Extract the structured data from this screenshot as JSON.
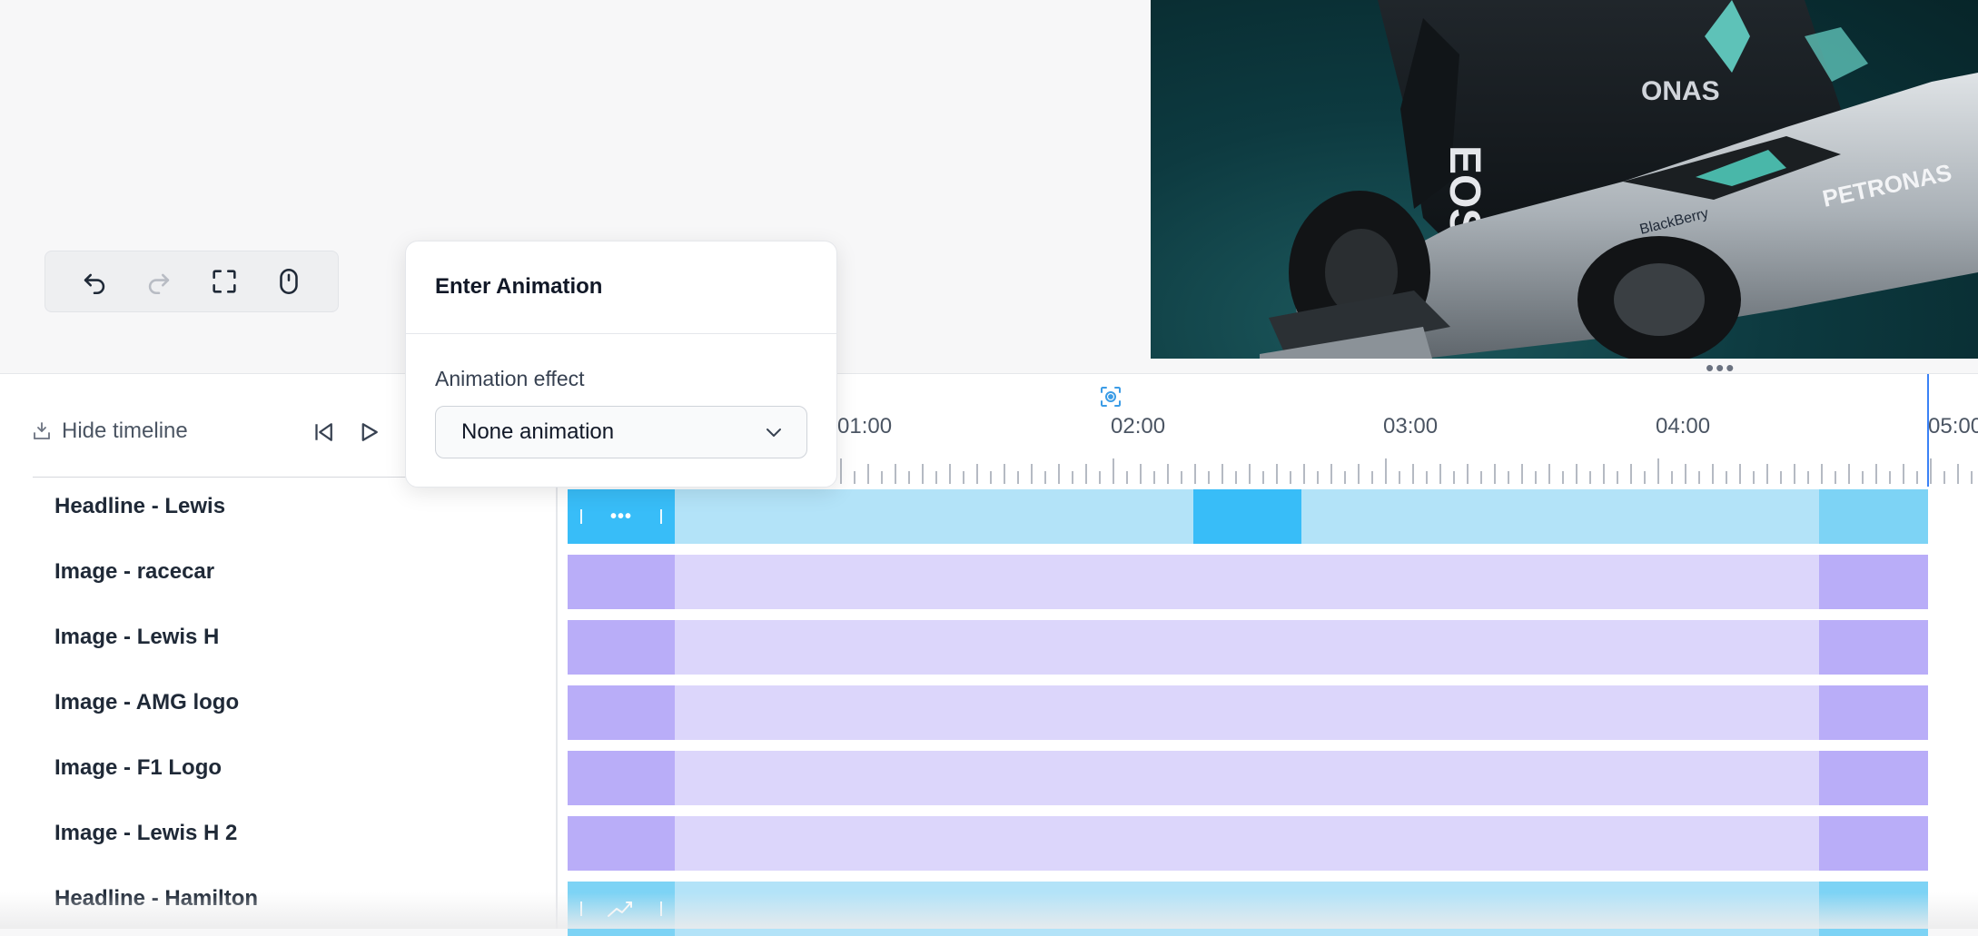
{
  "toolbar": {
    "undo_icon": "undo-icon",
    "redo_icon": "redo-icon",
    "fullscreen_icon": "fullscreen-icon",
    "mouse_icon": "mouse-icon"
  },
  "timeline": {
    "hide_label": "Hide timeline",
    "ruler": [
      "01:00",
      "02:00",
      "03:00",
      "04:00",
      "05:00"
    ],
    "layers": [
      {
        "label": "Headline - Lewis",
        "kind": "text"
      },
      {
        "label": "Image - racecar",
        "kind": "image"
      },
      {
        "label": "Image - Lewis H",
        "kind": "image"
      },
      {
        "label": "Image - AMG logo",
        "kind": "image"
      },
      {
        "label": "Image - F1 Logo",
        "kind": "image"
      },
      {
        "label": "Image - Lewis H 2",
        "kind": "image"
      },
      {
        "label": "Headline - Hamilton",
        "kind": "text"
      }
    ]
  },
  "popover": {
    "title": "Enter Animation",
    "effect_label": "Animation effect",
    "effect_value": "None animation"
  },
  "colors": {
    "text_track": "#b3e3f8",
    "text_track_strong": "#38bdf8",
    "text_track_end": "#7dd3f5",
    "image_track": "#dcd6fb",
    "image_track_strong": "#b9adf8",
    "playhead": "#3b82f6"
  }
}
